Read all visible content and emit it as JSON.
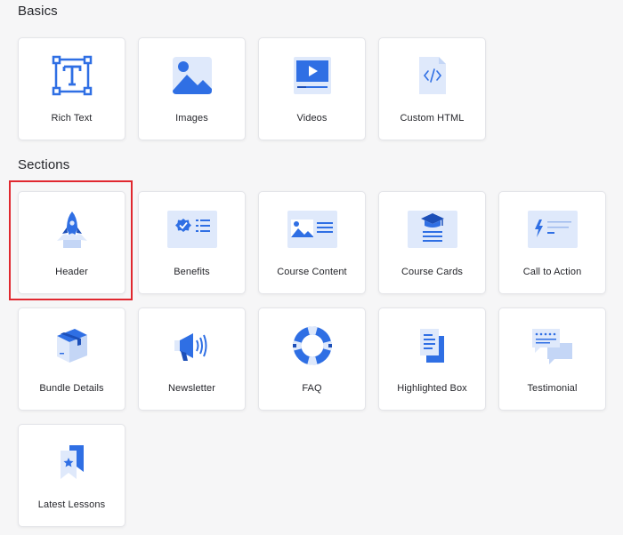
{
  "basics": {
    "title": "Basics",
    "items": [
      {
        "label": "Rich Text",
        "icon": "rich-text-icon"
      },
      {
        "label": "Images",
        "icon": "image-icon"
      },
      {
        "label": "Videos",
        "icon": "video-icon"
      },
      {
        "label": "Custom HTML",
        "icon": "code-file-icon"
      }
    ]
  },
  "sections": {
    "title": "Sections",
    "items": [
      {
        "label": "Header",
        "icon": "rocket-icon",
        "selected": true
      },
      {
        "label": "Benefits",
        "icon": "badge-check-list-icon"
      },
      {
        "label": "Course Content",
        "icon": "image-text-icon"
      },
      {
        "label": "Course Cards",
        "icon": "graduation-cap-card-icon"
      },
      {
        "label": "Call to Action",
        "icon": "lightning-icon"
      },
      {
        "label": "Bundle Details",
        "icon": "box-icon"
      },
      {
        "label": "Newsletter",
        "icon": "megaphone-icon"
      },
      {
        "label": "FAQ",
        "icon": "lifebuoy-icon"
      },
      {
        "label": "Highlighted Box",
        "icon": "highlighted-doc-icon"
      },
      {
        "label": "Testimonial",
        "icon": "chat-bubbles-icon"
      },
      {
        "label": "Latest Lessons",
        "icon": "bookmark-star-icon"
      }
    ]
  },
  "colors": {
    "accent": "#2f6fe4",
    "accent_light": "#dfe9fb",
    "selection_outline": "#e0282f",
    "background": "#f6f6f7"
  }
}
